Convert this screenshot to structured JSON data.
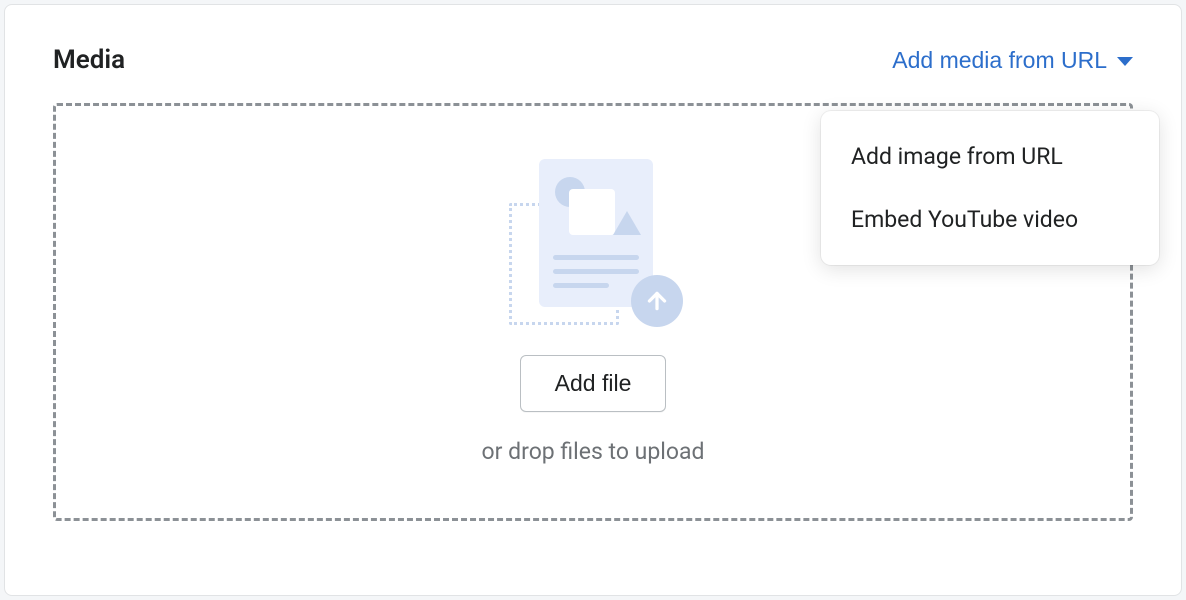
{
  "header": {
    "title": "Media",
    "add_from_url_label": "Add media from URL"
  },
  "dropzone": {
    "add_file_label": "Add file",
    "drop_hint": "or drop files to upload"
  },
  "dropdown": {
    "items": [
      {
        "label": "Add image from URL"
      },
      {
        "label": "Embed YouTube video"
      }
    ]
  }
}
